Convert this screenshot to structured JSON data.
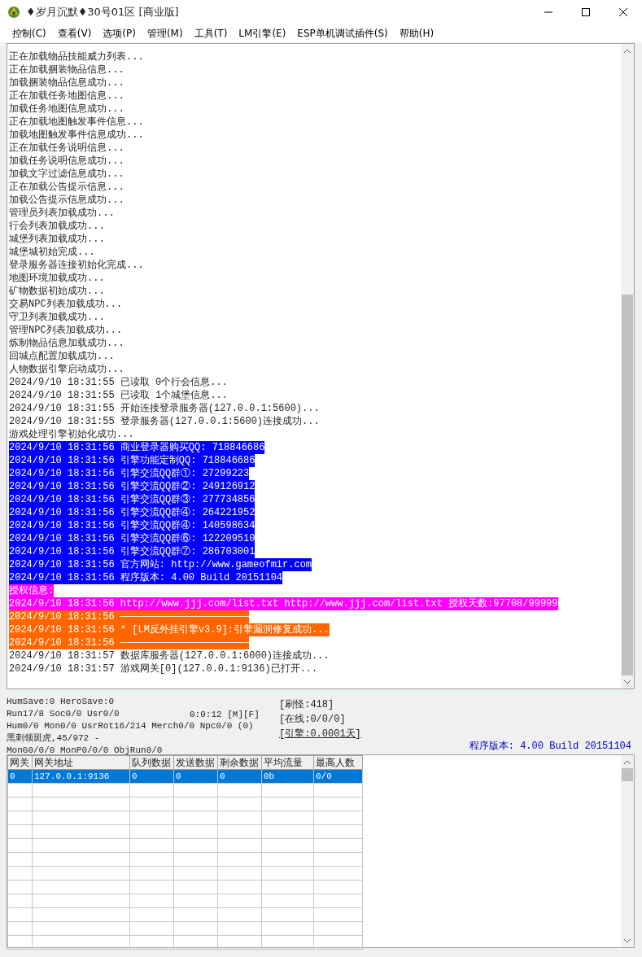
{
  "window": {
    "title": "♦岁月沉默♦30号01区 [商业版]"
  },
  "menu": [
    "控制(C)",
    "查看(V)",
    "选项(P)",
    "管理(M)",
    "工具(T)",
    "LM引擎(E)",
    "ESP单机调试插件(S)",
    "帮助(H)"
  ],
  "log": [
    {
      "text": "正在加载物品技能威力列表..."
    },
    {
      "text": "正在加载捆装物品信息..."
    },
    {
      "text": "加载捆装物品信息成功..."
    },
    {
      "text": "正在加载任务地图信息..."
    },
    {
      "text": "加载任务地图信息成功..."
    },
    {
      "text": "正在加载地图触发事件信息..."
    },
    {
      "text": "加载地图触发事件信息成功..."
    },
    {
      "text": "正在加载任务说明信息..."
    },
    {
      "text": "加载任务说明信息成功..."
    },
    {
      "text": "加载文字过滤信息成功..."
    },
    {
      "text": "正在加载公告提示信息..."
    },
    {
      "text": "加载公告提示信息成功..."
    },
    {
      "text": "管理员列表加载成功..."
    },
    {
      "text": "行会列表加载成功..."
    },
    {
      "text": "城堡列表加载成功..."
    },
    {
      "text": "城堡城初始完成..."
    },
    {
      "text": "登录服务器连接初始化完成..."
    },
    {
      "text": "地图环境加载成功..."
    },
    {
      "text": "矿物数据初始成功..."
    },
    {
      "text": "交易NPC列表加载成功..."
    },
    {
      "text": "守卫列表加载成功..."
    },
    {
      "text": "管理NPC列表加载成功..."
    },
    {
      "text": "炼制物品信息加载成功..."
    },
    {
      "text": "回城点配置加载成功..."
    },
    {
      "text": "人物数据引擎启动成功..."
    },
    {
      "text": "2024/9/10 18:31:55 已读取 0个行会信息..."
    },
    {
      "text": "2024/9/10 18:31:55 已读取 1个城堡信息..."
    },
    {
      "text": "2024/9/10 18:31:55 开始连接登录服务器(127.0.0.1:5600)..."
    },
    {
      "text": "2024/9/10 18:31:55 登录服务器(127.0.0.1:5600)连接成功..."
    },
    {
      "text": "游戏处理引擎初始化成功..."
    },
    {
      "text": "2024/9/10 18:31:56 商业登录器购买QQ: 718846686",
      "color": "#0000ff"
    },
    {
      "text": "2024/9/10 18:31:56 引擎功能定制QQ: 718846686",
      "color": "#0000ff"
    },
    {
      "text": "2024/9/10 18:31:56 引擎交流QQ群①: 27299223",
      "color": "#0000ff"
    },
    {
      "text": "2024/9/10 18:31:56 引擎交流QQ群②: 249126912",
      "color": "#0000ff"
    },
    {
      "text": "2024/9/10 18:31:56 引擎交流QQ群③: 277734856",
      "color": "#0000ff"
    },
    {
      "text": "2024/9/10 18:31:56 引擎交流QQ群④: 264221952",
      "color": "#0000ff"
    },
    {
      "text": "2024/9/10 18:31:56 引擎交流QQ群④: 140598634",
      "color": "#0000ff"
    },
    {
      "text": "2024/9/10 18:31:56 引擎交流QQ群⑥: 122209510",
      "color": "#0000ff"
    },
    {
      "text": "2024/9/10 18:31:56 引擎交流QQ群⑦: 286703001",
      "color": "#0000ff"
    },
    {
      "text": "2024/9/10 18:31:56 官方网站: http://www.gameofmir.com",
      "color": "#0000ff"
    },
    {
      "text": "2024/9/10 18:31:56 程序版本: 4.00 Build 20151104",
      "color": "#0000ff"
    },
    {
      "text": "授权信息:",
      "color": "#ff00ff"
    },
    {
      "text": "2024/9/10 18:31:56 http://www.jjj.com/list.txt http://www.jjj.com/list.txt 授权天数:97708/99999",
      "color": "#ff00ff"
    },
    {
      "text": "2024/9/10 18:31:56 ──────────────────────",
      "color": "#ff6600"
    },
    {
      "text": "2024/9/10 18:31:56 * [LM反外挂引擎v3.9]:引擎漏洞修复成功...",
      "color": "#ff6600"
    },
    {
      "text": "2024/9/10 18:31:56 ──────────────────────",
      "color": "#ff6600"
    },
    {
      "text": "2024/9/10 18:31:57 数据库服务器(127.0.0.1:6000)连接成功..."
    },
    {
      "text": "2024/9/10 18:31:57 游戏网关[0](127.0.0.1:9136)已打开..."
    }
  ],
  "status": {
    "left": [
      "HumSave:0 HeroSave:0",
      "Run17/8 Soc0/0 Usr0/0",
      "Hum0/0 Mon0/0 UsrRot16/214 Merch0/0 Npc0/0 (0)",
      "黑刺领斑虎,45/972 -",
      "MonG0/0/0 MonP0/0/0 ObjRun0/0"
    ],
    "timer": "0:0:12 [M][F]",
    "right": [
      "[刷怪:418]",
      "[在线:0/0/0]",
      "[引擎:0.0001天]"
    ],
    "version": "程序版本: 4.00 Build 20151104"
  },
  "table": {
    "columns": [
      "网关",
      "网关地址",
      "队列数据",
      "发送数据",
      "剩余数据",
      "平均流量",
      "最高人数"
    ],
    "rows": [
      {
        "cells": [
          "0",
          "127.0.0.1:9136",
          "0",
          "0",
          "0",
          "0b",
          "0/0"
        ],
        "selected": true
      }
    ]
  }
}
